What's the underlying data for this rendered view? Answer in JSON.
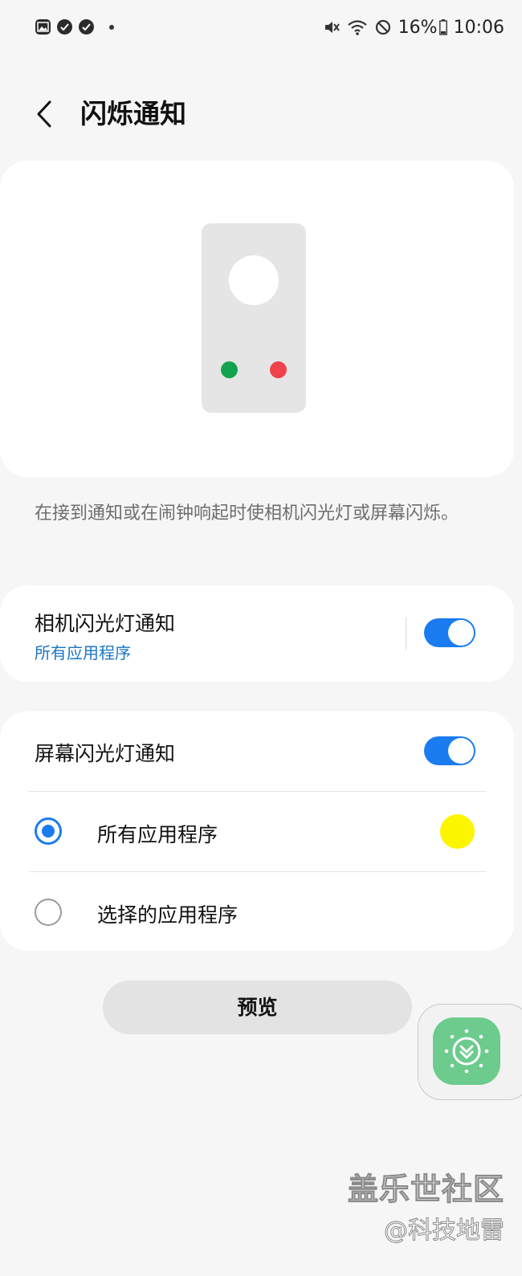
{
  "status_bar": {
    "battery": "16%",
    "time": "10:06",
    "left_icons": [
      "gallery-icon",
      "check-app-icon",
      "check-app-icon-2"
    ],
    "right_icons": [
      "mute-icon",
      "wifi-icon",
      "do-not-disturb-icon",
      "battery-icon"
    ]
  },
  "header": {
    "title": "闪烁通知"
  },
  "preview_illustration": {
    "led_colors": [
      "#13a34f",
      "#f0424b"
    ]
  },
  "description": "在接到通知或在闹钟响起时使相机闪光灯或屏幕闪烁。",
  "camera_flash": {
    "title": "相机闪光灯通知",
    "subtitle": "所有应用程序",
    "enabled": true
  },
  "screen_flash": {
    "title": "屏幕闪光灯通知",
    "enabled": true,
    "options": [
      {
        "label": "所有应用程序",
        "selected": true,
        "color": "#fcf500"
      },
      {
        "label": "选择的应用程序",
        "selected": false
      }
    ]
  },
  "preview_button": {
    "label": "预览"
  },
  "colors": {
    "accent": "#1a7cf0",
    "link": "#1b74c4",
    "float_button": "#6ccb8d"
  },
  "watermark": {
    "line1": "盖乐世社区",
    "line2": "@科技地雷"
  }
}
